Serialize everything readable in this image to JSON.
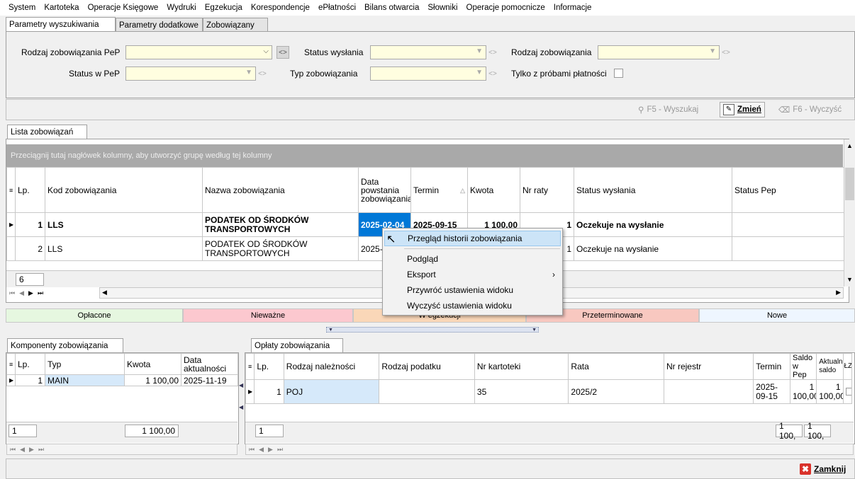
{
  "menu": [
    "System",
    "Kartoteka",
    "Operacje Księgowe",
    "Wydruki",
    "Egzekucja",
    "Korespondencje",
    "ePłatności",
    "Bilans otwarcia",
    "Słowniki",
    "Operacje pomocnicze",
    "Informacje"
  ],
  "tabs": [
    "Parametry wyszukiwania",
    "Parametry dodatkowe",
    "Zobowiązany"
  ],
  "filters": {
    "rodzaj_pep": "Rodzaj zobowiązania PeP",
    "status_wyslania": "Status wysłania",
    "rodzaj_zob": "Rodzaj zobowiązania",
    "status_pep": "Status w PeP",
    "typ_zob": "Typ zobowiązania",
    "tylko_proby": "Tylko z próbami płatności"
  },
  "toolbar": {
    "search": "F5 - Wyszukaj",
    "change": "Zmień",
    "clear": "F6 - Wyczyść"
  },
  "list": {
    "tab": "Lista zobowiązań",
    "group_hint": "Przeciągnij tutaj nagłówek kolumny, aby utworzyć grupę według tej kolumny",
    "columns": [
      "Lp.",
      "Kod zobowiązania",
      "Nazwa zobowiązania",
      "Data powstania zobowiązania",
      "Termin",
      "Kwota",
      "Nr raty",
      "Status wysłania",
      "Status Pep"
    ],
    "rows": [
      {
        "lp": "1",
        "kod": "LLS",
        "nazwa": "PODATEK OD ŚRODKÓW TRANSPORTOWYCH",
        "data": "2025-02-04",
        "termin": "2025-09-15",
        "kwota": "1 100,00",
        "nr_raty": "1",
        "status": "Oczekuje na wysłanie",
        "pep": ""
      },
      {
        "lp": "2",
        "kod": "LLS",
        "nazwa": "PODATEK OD ŚRODKÓW TRANSPORTOWYCH",
        "data": "2025-",
        "termin": "",
        "kwota": "",
        "nr_raty": "1",
        "status": "Oczekuje na wysłanie",
        "pep": ""
      }
    ],
    "count": "6"
  },
  "legend": [
    "Opłacone",
    "Nieważne",
    "W egzekucji",
    "Przeterminowane",
    "Nowe"
  ],
  "context_menu": [
    "Przegląd historii zobowiązania",
    "Podgląd",
    "Eksport",
    "Przywróć ustawienia widoku",
    "Wyczyść ustawienia widoku"
  ],
  "components": {
    "tab": "Komponenty zobowiązania",
    "columns": [
      "Lp.",
      "Typ",
      "Kwota",
      "Data aktualności"
    ],
    "rows": [
      {
        "lp": "1",
        "typ": "MAIN",
        "kwota": "1 100,00",
        "data": "2025-11-19"
      }
    ],
    "count": "1",
    "sum": "1 100,00"
  },
  "fees": {
    "tab": "Opłaty zobowiązania",
    "columns": [
      "Lp.",
      "Rodzaj należności",
      "Rodzaj podatku",
      "Nr kartoteki",
      "Rata",
      "Nr rejestr",
      "Termin",
      "Saldo w Pep",
      "Aktualne saldo",
      "ŁZP"
    ],
    "rows": [
      {
        "lp": "1",
        "rodzaj": "POJ",
        "podatek": "",
        "kartoteka": "35",
        "rata": "2025/2",
        "rejestr": "",
        "termin": "2025-09-15",
        "saldo_pep": "1 100,00",
        "saldo": "1 100,00"
      }
    ],
    "count": "1",
    "sum1": "1 100,",
    "sum2": "1 100,"
  },
  "close": "Zamknij",
  "colors": {
    "selected": "#0078d7",
    "group_bar": "#a9a9a9",
    "combo": "#fffee0",
    "opl": "#e6f7e0",
    "niew": "#fcc8cf",
    "egz": "#fad7b8",
    "przet": "#f8c8c0",
    "nowe": "#eef6ff"
  }
}
